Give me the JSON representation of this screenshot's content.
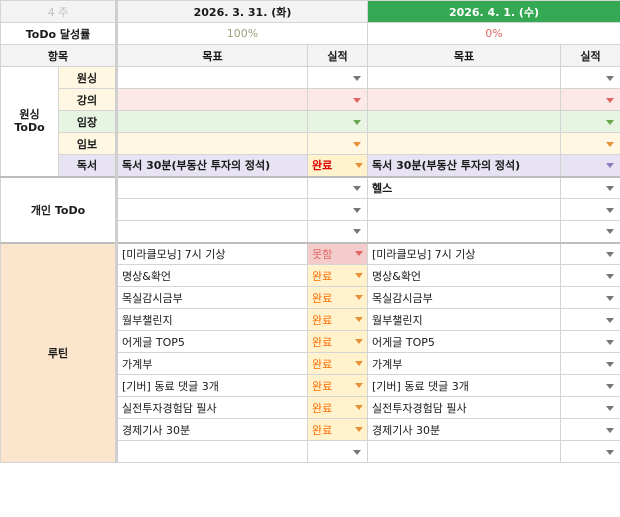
{
  "header": {
    "week_label": "주",
    "week_num": "4",
    "date1": "2026. 3. 31. (화)",
    "date2": "2026. 4. 1. (수)"
  },
  "achievement": {
    "label": "ToDo 달성률",
    "day1": "100%",
    "day2": "0%"
  },
  "columns": {
    "item": "항목",
    "goal": "목표",
    "result": "실적"
  },
  "groups": {
    "wonsing": "원싱\nToDo",
    "personal": "개인 ToDo",
    "routine": "루틴"
  },
  "wonsing_rows": [
    {
      "label": "원싱",
      "d1_goal": "",
      "d1_result": "",
      "d2_goal": "",
      "d2_result": ""
    },
    {
      "label": "강의",
      "d1_goal": "",
      "d1_result": "",
      "d2_goal": "",
      "d2_result": ""
    },
    {
      "label": "임장",
      "d1_goal": "",
      "d1_result": "",
      "d2_goal": "",
      "d2_result": ""
    },
    {
      "label": "임보",
      "d1_goal": "",
      "d1_result": "",
      "d2_goal": "",
      "d2_result": ""
    },
    {
      "label": "독서",
      "d1_goal": "독서 30분(부동산 투자의 정석)",
      "d1_result": "완료",
      "d2_goal": "독서 30분(부동산 투자의 정석)",
      "d2_result": ""
    }
  ],
  "personal_rows": [
    {
      "d1_goal": "",
      "d2_goal": "헬스"
    },
    {
      "d1_goal": "",
      "d2_goal": ""
    },
    {
      "d1_goal": "",
      "d2_goal": ""
    }
  ],
  "routine_rows": [
    {
      "d1_goal": "[미라클모닝] 7시 기상",
      "d1_result": "못함",
      "d2_goal": "[미라클모닝] 7시 기상"
    },
    {
      "d1_goal": "명상&확언",
      "d1_result": "완료",
      "d2_goal": "명상&확언"
    },
    {
      "d1_goal": "목실감시금부",
      "d1_result": "완료",
      "d2_goal": "목실감시금부"
    },
    {
      "d1_goal": "월부챌린지",
      "d1_result": "완료",
      "d2_goal": "월부챌린지"
    },
    {
      "d1_goal": "어게글 TOP5",
      "d1_result": "완료",
      "d2_goal": "어게글 TOP5"
    },
    {
      "d1_goal": "가계부",
      "d1_result": "완료",
      "d2_goal": "가계부"
    },
    {
      "d1_goal": "[기버] 동료 댓글 3개",
      "d1_result": "완료",
      "d2_goal": "[기버] 동료 댓글 3개"
    },
    {
      "d1_goal": "실전투자경험담 필사",
      "d1_result": "완료",
      "d2_goal": "실전투자경험담 필사"
    },
    {
      "d1_goal": "경제기사 30분",
      "d1_result": "완료",
      "d2_goal": "경제기사 30분"
    },
    {
      "d1_goal": "",
      "d1_result": "",
      "d2_goal": ""
    }
  ],
  "colors": {
    "header_gray": "#f3f3f3",
    "date2_green": "#34a853",
    "wonsing_red": "#fce8e6",
    "wonsing_green": "#e6f4e1",
    "wonsing_yellow": "#fff7e1",
    "wonsing_purple": "#e8e3f3",
    "routine_peach": "#fce5cd",
    "fail_pink": "#f4cccc",
    "done_yellow": "#fff2cc"
  }
}
